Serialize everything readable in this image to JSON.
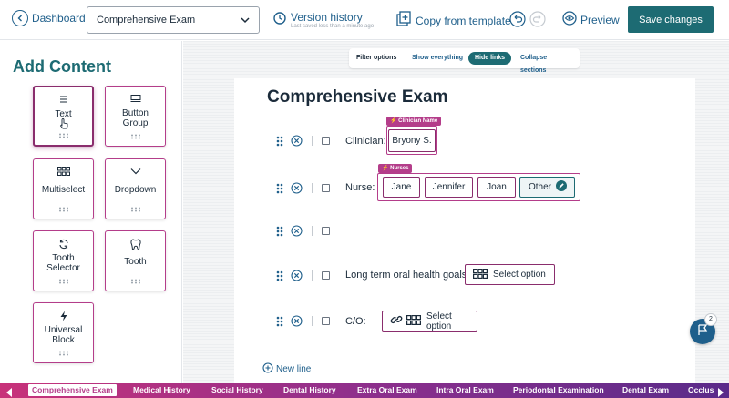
{
  "header": {
    "back_label": "Dashboard",
    "template_select": "Comprehensive Exam",
    "version_label": "Version history",
    "version_sub": "Last saved less than a minute ago",
    "copy_label": "Copy from template",
    "preview_label": "Preview",
    "save_label": "Save changes"
  },
  "sidebar": {
    "title": "Add Content",
    "blocks": [
      {
        "label": "Text",
        "icon": "text-lines-icon"
      },
      {
        "label": "Button Group",
        "icon": "button-group-icon"
      },
      {
        "label": "Multiselect",
        "icon": "grid-icon"
      },
      {
        "label": "Dropdown",
        "icon": "chevron-down-icon"
      },
      {
        "label": "Tooth Selector",
        "icon": "refresh-icon"
      },
      {
        "label": "Tooth",
        "icon": "tooth-icon"
      },
      {
        "label": "Universal Block",
        "icon": "lightning-icon"
      }
    ]
  },
  "filter": {
    "label": "Filter options",
    "options": [
      "Show everything",
      "Hide links",
      "Collapse sections"
    ],
    "selected": "Hide links"
  },
  "document": {
    "title": "Comprehensive Exam",
    "rows": [
      {
        "label": "Clinician:",
        "tag": "Clinician Name",
        "value": "Bryony S."
      },
      {
        "label": "Nurse:",
        "tag": "Nurses",
        "options": [
          "Jane",
          "Jennifer",
          "Joan",
          "Other"
        ]
      },
      {
        "label": ""
      },
      {
        "label": "Long term oral health goals:",
        "select": "Select option"
      },
      {
        "label": "C/O:",
        "select": "Select option"
      }
    ],
    "new_line_label": "New line"
  },
  "fab": {
    "badge": "2"
  },
  "tabs": [
    "Comprehensive Exam",
    "Medical History",
    "Social History",
    "Dental History",
    "Extra Oral Exam",
    "Intra Oral Exam",
    "Periodontal Examination",
    "Dental Exam",
    "Occlus"
  ],
  "active_tab": "Comprehensive Exam",
  "colors": {
    "accent": "#1d6b73",
    "brand": "#b43d8a",
    "link": "#1f5f8b"
  }
}
